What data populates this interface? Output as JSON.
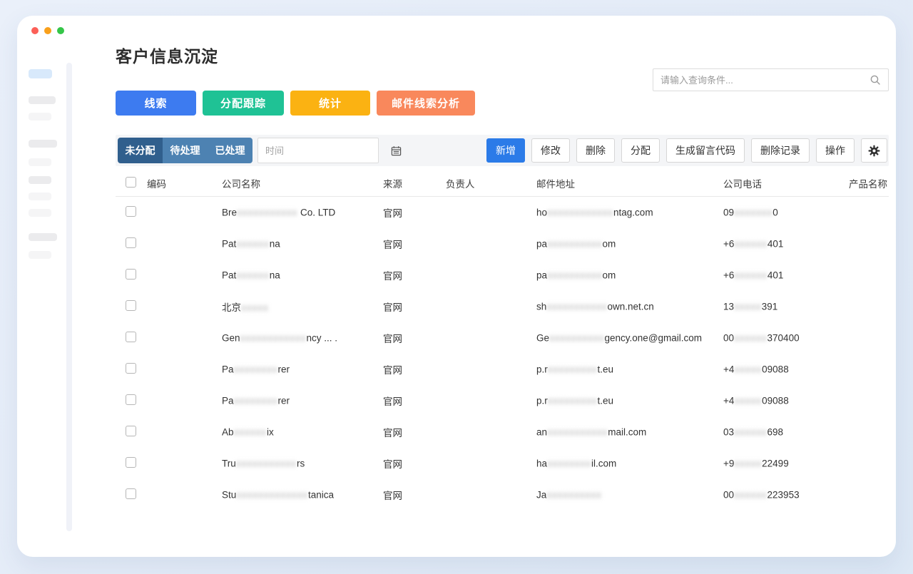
{
  "window": {
    "traffic_lights": {
      "close": "#fc5f57",
      "minimize": "#f9a01b",
      "zoom": "#35c648"
    }
  },
  "header": {
    "title": "客户信息沉淀",
    "search_placeholder": "请输入查询条件...",
    "search_icon": "magnifier"
  },
  "nav_buttons": [
    {
      "label": "线索",
      "color": "#3d7bf0"
    },
    {
      "label": "分配跟踪",
      "color": "#1fc295"
    },
    {
      "label": "统计",
      "color": "#fbb212"
    },
    {
      "label": "邮件线索分析",
      "color": "#f9885c"
    }
  ],
  "filter": {
    "tabs": [
      {
        "label": "未分配",
        "active": true
      },
      {
        "label": "待处理",
        "active": false
      },
      {
        "label": "已处理",
        "active": false
      }
    ],
    "date_placeholder": "时间",
    "calendar_icon": "calendar",
    "tab_active_color": "#305f8d",
    "tab_color": "#4d82b2"
  },
  "actions": [
    {
      "label": "新增",
      "primary": true
    },
    {
      "label": "修改",
      "primary": false
    },
    {
      "label": "删除",
      "primary": false
    },
    {
      "label": "分配",
      "primary": false
    },
    {
      "label": "生成留言代码",
      "primary": false
    },
    {
      "label": "删除记录",
      "primary": false
    },
    {
      "label": "操作",
      "primary": false
    }
  ],
  "settings_icon": "gear",
  "table": {
    "headers": [
      "编码",
      "公司名称",
      "来源",
      "负责人",
      "邮件地址",
      "公司电话",
      "产品名称"
    ],
    "rows": [
      {
        "company_pre": "Bre",
        "company_blur": "xxxxxxxxxxx",
        "company_post": " Co. LTD",
        "source": "官网",
        "email_pre": "ho",
        "email_blur": "xxxxxxxxxxxx",
        "email_post": "ntag.com",
        "phone_pre": "09",
        "phone_blur": "xxxxxxx",
        "phone_post": "0"
      },
      {
        "company_pre": "Pat",
        "company_blur": "xxxxxx",
        "company_post": "na",
        "source": "官网",
        "email_pre": "pa",
        "email_blur": "xxxxxxxxxx",
        "email_post": "om",
        "phone_pre": "+6",
        "phone_blur": "xxxxxx",
        "phone_post": "401"
      },
      {
        "company_pre": "Pat",
        "company_blur": "xxxxxx",
        "company_post": "na",
        "source": "官网",
        "email_pre": "pa",
        "email_blur": "xxxxxxxxxx",
        "email_post": "om",
        "phone_pre": "+6",
        "phone_blur": "xxxxxx",
        "phone_post": "401"
      },
      {
        "company_pre": "北京",
        "company_blur": "xxxxx",
        "company_post": "",
        "source": "官网",
        "email_pre": "sh",
        "email_blur": "xxxxxxxxxxx",
        "email_post": "own.net.cn",
        "phone_pre": "13",
        "phone_blur": "xxxxx",
        "phone_post": "391"
      },
      {
        "company_pre": "Gen",
        "company_blur": "xxxxxxxxxxxx",
        "company_post": "ncy ...    .",
        "source": "官网",
        "email_pre": "Ge",
        "email_blur": "xxxxxxxxxx",
        "email_post": "gency.one@gmail.com",
        "phone_pre": "00",
        "phone_blur": "xxxxxx",
        "phone_post": "370400"
      },
      {
        "company_pre": "Pa",
        "company_blur": "xxxxxxxx",
        "company_post": "rer",
        "source": "官网",
        "email_pre": "p.r",
        "email_blur": "xxxxxxxxx",
        "email_post": "t.eu",
        "phone_pre": "+4",
        "phone_blur": "xxxxx",
        "phone_post": "09088"
      },
      {
        "company_pre": "Pa",
        "company_blur": "xxxxxxxx",
        "company_post": "rer",
        "source": "官网",
        "email_pre": "p.r",
        "email_blur": "xxxxxxxxx",
        "email_post": "t.eu",
        "phone_pre": "+4",
        "phone_blur": "xxxxx",
        "phone_post": "09088"
      },
      {
        "company_pre": "Ab",
        "company_blur": "xxxxxx",
        "company_post": "ix",
        "source": "官网",
        "email_pre": "an",
        "email_blur": "xxxxxxxxxxx",
        "email_post": "mail.com",
        "phone_pre": "03",
        "phone_blur": "xxxxxx",
        "phone_post": "698"
      },
      {
        "company_pre": "Tru",
        "company_blur": "xxxxxxxxxxx",
        "company_post": "rs",
        "source": "官网",
        "email_pre": "ha",
        "email_blur": "xxxxxxxx",
        "email_post": "il.com",
        "phone_pre": "+9",
        "phone_blur": "xxxxx",
        "phone_post": "22499"
      },
      {
        "company_pre": "Stu",
        "company_blur": "xxxxxxxxxxxxx",
        "company_post": "tanica",
        "source": "官网",
        "email_pre": "Ja",
        "email_blur": "xxxxxxxxxx",
        "email_post": "",
        "phone_pre": "00",
        "phone_blur": "xxxxxx",
        "phone_post": "223953"
      }
    ]
  }
}
